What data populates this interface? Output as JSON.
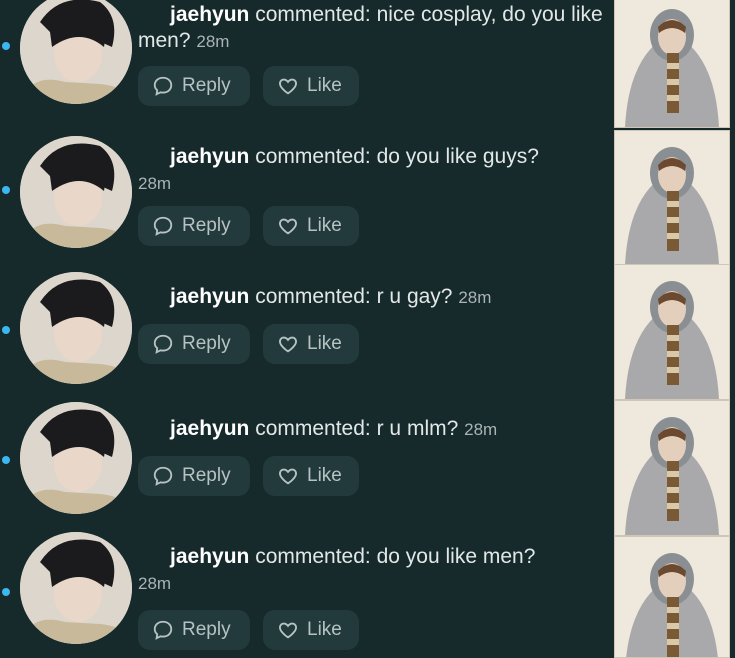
{
  "comments": [
    {
      "user": "jaehyun",
      "verb": "commented:",
      "text": "nice cosplay, do you like men?",
      "time": "28m"
    },
    {
      "user": "jaehyun",
      "verb": "commented:",
      "text": "do you like guys?",
      "time": "28m"
    },
    {
      "user": "jaehyun",
      "verb": "commented:",
      "text": "r u gay?",
      "time": "28m"
    },
    {
      "user": "jaehyun",
      "verb": "commented:",
      "text": "r u mlm?",
      "time": "28m"
    },
    {
      "user": "jaehyun",
      "verb": "commented:",
      "text": "do you like men?",
      "time": "28m"
    }
  ],
  "actions": {
    "reply_label": "Reply",
    "like_label": "Like"
  },
  "icons": {
    "reply": "speech-bubble-icon",
    "like": "heart-outline-icon"
  },
  "colors": {
    "background": "#16292b",
    "button_bg": "#223a3c",
    "unread_dot": "#3cb7f0"
  }
}
